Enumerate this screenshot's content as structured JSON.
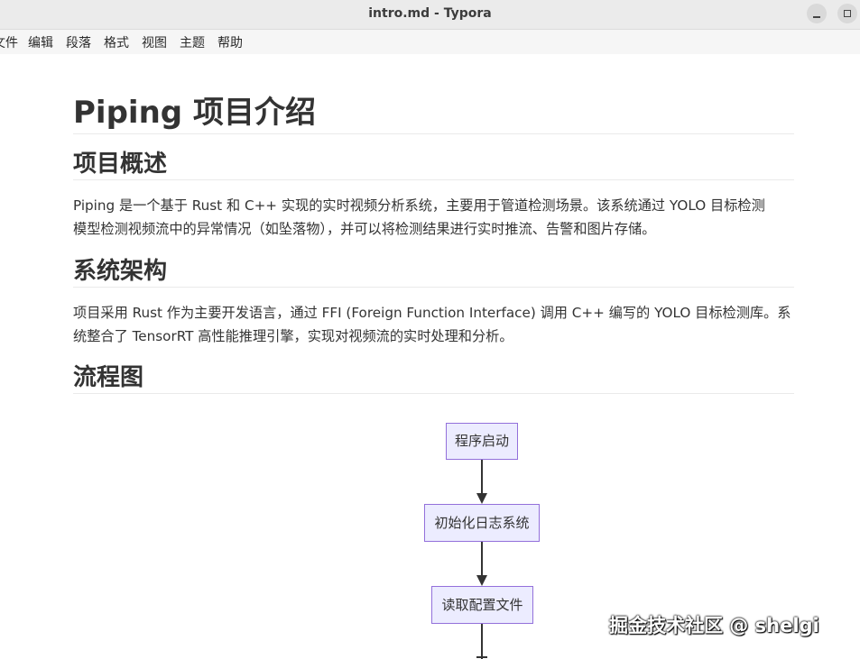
{
  "window": {
    "title": "intro.md - Typora"
  },
  "menu": {
    "items": [
      "文件",
      "编辑",
      "段落",
      "格式",
      "视图",
      "主题",
      "帮助"
    ]
  },
  "document": {
    "h1": "Piping 项目介绍",
    "sections": [
      {
        "heading": "项目概述",
        "lines": [
          "Piping 是一个基于 Rust 和 C++ 实现的实时视频分析系统，主要用于管道检测场景。该系统通过 YOLO 目标检测",
          "模型检测视频流中的异常情况（如坠落物），并可以将检测结果进行实时推流、告警和图片存储。"
        ]
      },
      {
        "heading": "系统架构",
        "lines": [
          "项目采用 Rust 作为主要开发语言，通过 FFI (Foreign Function Interface) 调用 C++ 编写的 YOLO 目标检测库。系",
          "统整合了 TensorRT 高性能推理引擎，实现对视频流的实时处理和分析。"
        ]
      },
      {
        "heading": "流程图",
        "lines": []
      }
    ]
  },
  "flowchart": {
    "nodes": [
      "程序启动",
      "初始化日志系统",
      "读取配置文件"
    ],
    "colors": {
      "fill": "#ECECFF",
      "stroke": "#9370DB",
      "edge": "#333333"
    }
  },
  "watermark": "掘金技术社区 @ shelgi"
}
